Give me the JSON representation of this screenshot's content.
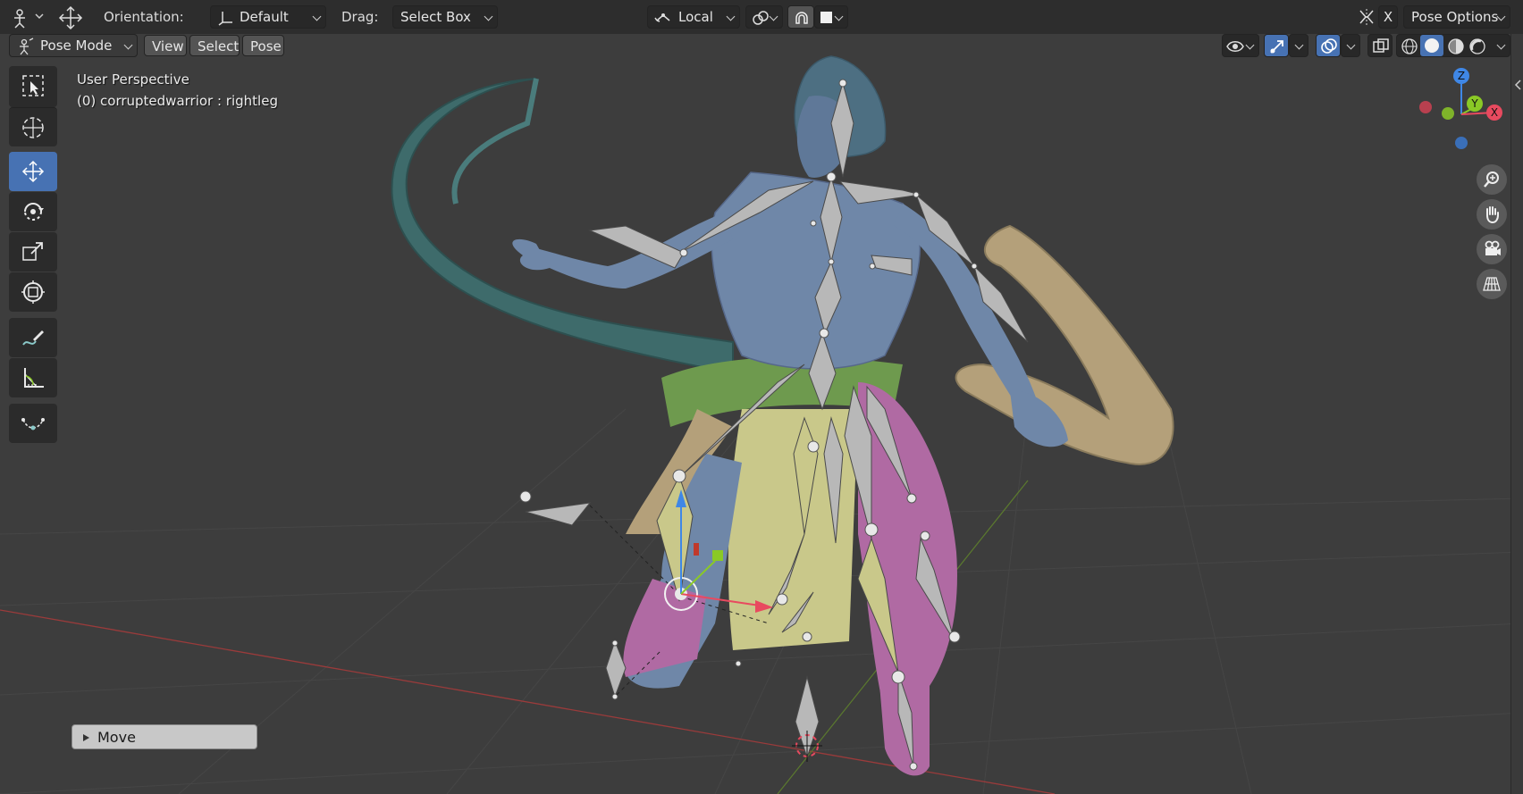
{
  "topbar": {
    "orientation_label": "Orientation:",
    "orientation_value": "Default",
    "drag_label": "Drag:",
    "drag_value": "Select Box",
    "pivot_value": "Local",
    "x_label": "X",
    "pose_options_label": "Pose Options"
  },
  "header": {
    "mode_value": "Pose Mode",
    "menu_view": "View",
    "menu_select": "Select",
    "menu_pose": "Pose"
  },
  "toolbar": {
    "tools": [
      {
        "name": "select-box-tool",
        "icon": "select-box-icon",
        "active": false
      },
      {
        "name": "cursor-tool",
        "icon": "cursor-icon",
        "active": false
      },
      {
        "name": "move-tool",
        "icon": "move-icon",
        "active": true
      },
      {
        "name": "rotate-tool",
        "icon": "rotate-icon",
        "active": false
      },
      {
        "name": "scale-tool",
        "icon": "scale-icon",
        "active": false
      },
      {
        "name": "transform-tool",
        "icon": "transform-icon",
        "active": false
      },
      {
        "name": "annotate-tool",
        "icon": "annotate-icon",
        "active": false
      },
      {
        "name": "measure-tool",
        "icon": "measure-icon",
        "active": false
      },
      {
        "name": "relax-tool",
        "icon": "curve-icon",
        "active": false
      }
    ]
  },
  "viewport": {
    "perspective_label": "User Perspective",
    "object_label": "(0) corruptedwarrior : rightleg",
    "gizmo_z": "Z",
    "gizmo_y": "Y",
    "gizmo_x": "X"
  },
  "operator_panel": {
    "label": "Move"
  },
  "colors": {
    "accent_blue": "#4772b3",
    "axis_x": "#e84a5f",
    "axis_y": "#8ac926",
    "axis_z": "#3f87e6",
    "skin": "#6f87a8",
    "cloak": "#3e6b6b",
    "pants": "#b06aa3",
    "sash": "#6e9a4e",
    "shield": "#b4a07a",
    "bones": "#b8b8b8"
  }
}
